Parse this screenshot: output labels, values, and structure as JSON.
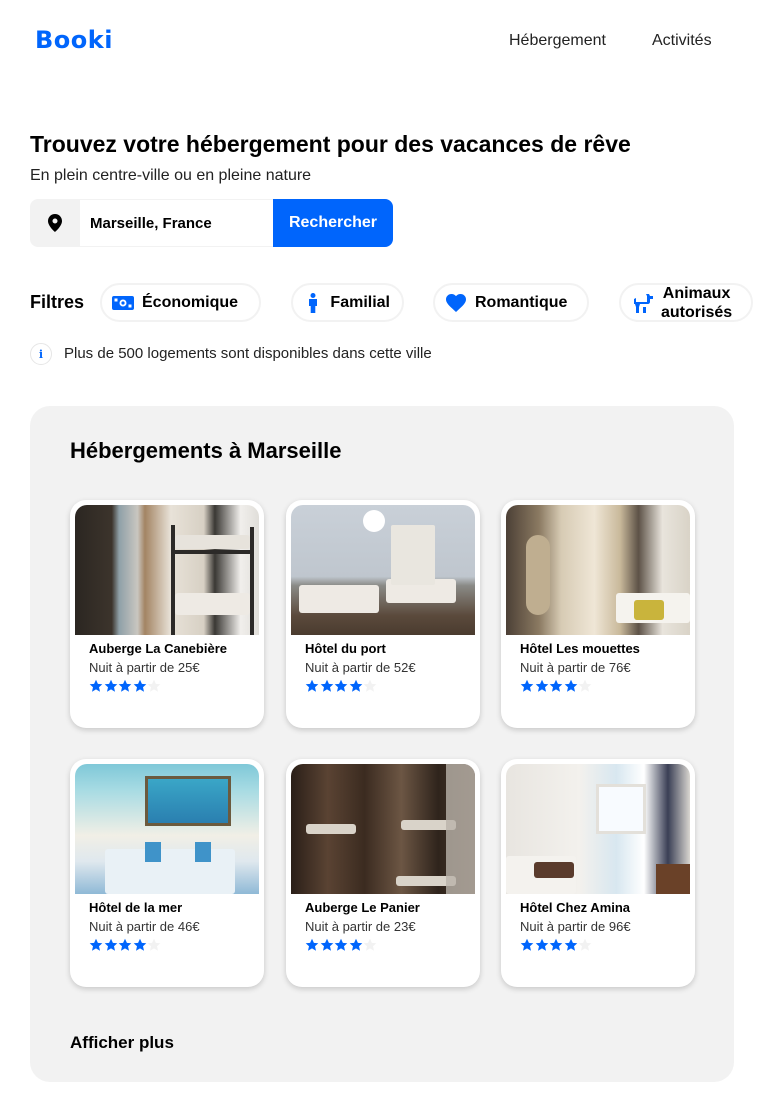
{
  "header": {
    "logo": "Booki",
    "nav": [
      "Hébergement",
      "Activités"
    ]
  },
  "hero": {
    "title": "Trouvez votre hébergement pour des vacances de rêve",
    "subtitle": "En plein centre-ville ou en pleine nature"
  },
  "search": {
    "value": "Marseille, France",
    "placeholder": "Marseille, France",
    "button": "Rechercher"
  },
  "filters": {
    "label": "Filtres",
    "chips": [
      {
        "label": "Économique",
        "icon": "money-icon"
      },
      {
        "label": "Familial",
        "icon": "person-icon"
      },
      {
        "label": "Romantique",
        "icon": "heart-icon"
      },
      {
        "label_line1": "Animaux",
        "label_line2": "autorisés",
        "icon": "dog-icon"
      }
    ]
  },
  "info": {
    "icon": "info-icon",
    "text": "Plus de 500 logements sont disponibles dans cette ville"
  },
  "listings": {
    "title": "Hébergements à Marseille",
    "more": "Afficher plus",
    "items": [
      {
        "name": "Auberge La Canebière",
        "price": "Nuit à partir de 25€",
        "rating": 4
      },
      {
        "name": "Hôtel du port",
        "price": "Nuit à partir de 52€",
        "rating": 4
      },
      {
        "name": "Hôtel Les mouettes",
        "price": "Nuit à partir de 76€",
        "rating": 4
      },
      {
        "name": "Hôtel de la mer",
        "price": "Nuit à partir de 46€",
        "rating": 4
      },
      {
        "name": "Auberge Le Panier",
        "price": "Nuit à partir de 23€",
        "rating": 4
      },
      {
        "name": "Hôtel Chez Amina",
        "price": "Nuit à partir de 96€",
        "rating": 4
      }
    ]
  },
  "colors": {
    "accent": "#0065FC",
    "panel": "#F2F2F2"
  }
}
